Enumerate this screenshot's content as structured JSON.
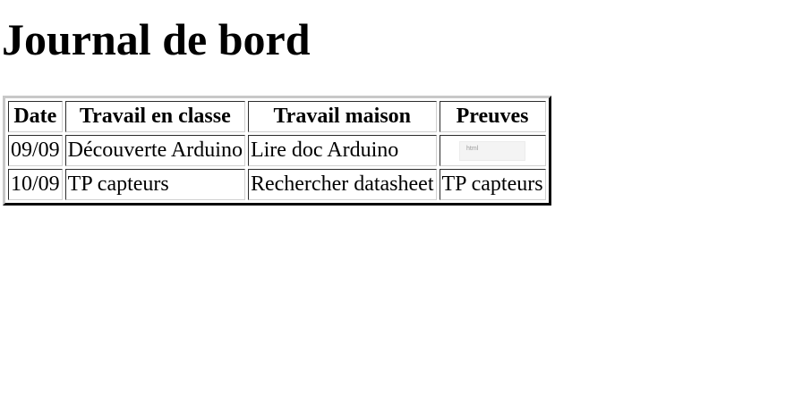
{
  "page": {
    "title": "Journal de bord"
  },
  "table": {
    "headers": [
      "Date",
      "Travail en classe",
      "Travail maison",
      "Preuves"
    ],
    "rows": [
      {
        "date": "09/09",
        "classe": "Découverte Arduino",
        "maison": "Lire doc Arduino",
        "preuves": "",
        "preuves_thumb_text": "html"
      },
      {
        "date": "10/09",
        "classe": "TP capteurs",
        "maison": "Rechercher datasheet",
        "preuves": "TP capteurs"
      }
    ]
  }
}
